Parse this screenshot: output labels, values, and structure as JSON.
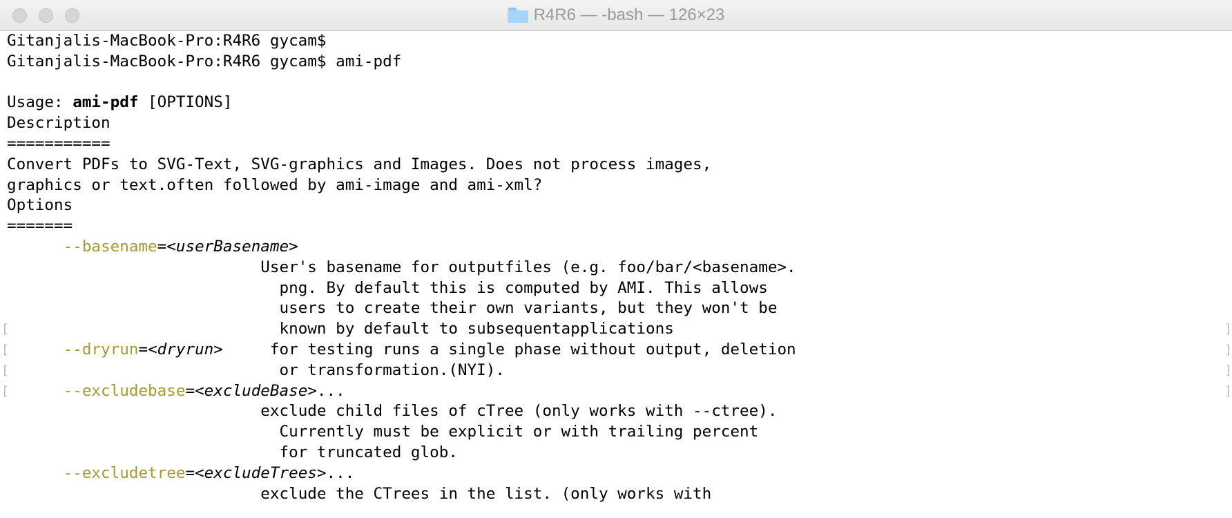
{
  "window": {
    "title": "R4R6 — -bash — 126×23"
  },
  "terminal": {
    "prompt": "Gitanjalis-MacBook-Pro:R4R6 gycam$",
    "command": "ami-pdf",
    "usage_prefix": "Usage: ",
    "usage_cmd": "ami-pdf",
    "usage_rest": " [OPTIONS]",
    "description_header": "Description",
    "description_rule": "===========",
    "description_line1": "Convert PDFs to SVG-Text, SVG-graphics and Images. Does not process images,",
    "description_line2": "graphics or text.often followed by ami-image and ami-xml?",
    "options_header": "Options",
    "options_rule": "=======",
    "bracket_left": "[",
    "bracket_right": "]",
    "options": {
      "basename": {
        "flag": "--basename",
        "arg": "<userBasename>",
        "desc": [
          "User's basename for outputfiles (e.g. foo/bar/<basename>.",
          "png. By default this is computed by AMI. This allows",
          "users to create their own variants, but they won't be",
          "known by default to subsequentapplications"
        ]
      },
      "dryrun": {
        "flag": "--dryrun",
        "arg": "<dryrun>",
        "desc": [
          "for testing runs a single phase without output, deletion",
          "or transformation.(NYI)."
        ]
      },
      "excludebase": {
        "flag": "--excludebase",
        "arg": "<excludeBase>",
        "ellipsis": "...",
        "desc": [
          "exclude child files of cTree (only works with --ctree).",
          "Currently must be explicit or with trailing percent",
          "for truncated glob."
        ]
      },
      "excludetree": {
        "flag": "--excludetree",
        "arg": "<excludeTrees>",
        "ellipsis": "...",
        "desc": [
          "exclude the CTrees in the list. (only works with"
        ]
      }
    }
  }
}
